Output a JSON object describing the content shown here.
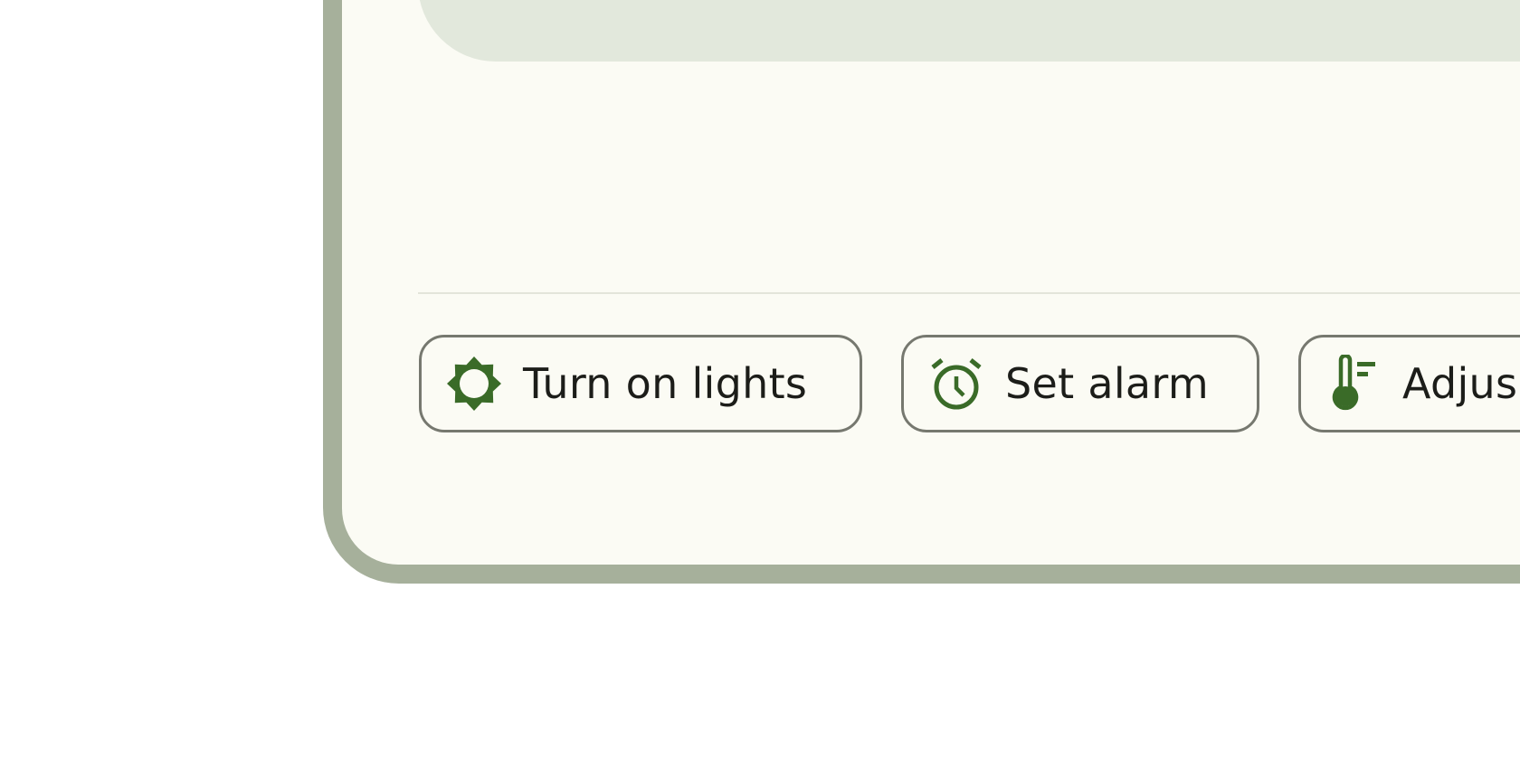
{
  "quick_actions": [
    {
      "label": "Turn on lights",
      "icon": "brightness-icon"
    },
    {
      "label": "Set alarm",
      "icon": "alarm-clock-icon"
    },
    {
      "label": "Adjus",
      "icon": "thermostat-icon"
    }
  ],
  "colors": {
    "accent": "#3a6b28",
    "frame": "#a6b09b",
    "surface": "#fbfbf4",
    "panel": "#e2e8dc",
    "chip_border": "#76786f",
    "text": "#1c1d19"
  }
}
